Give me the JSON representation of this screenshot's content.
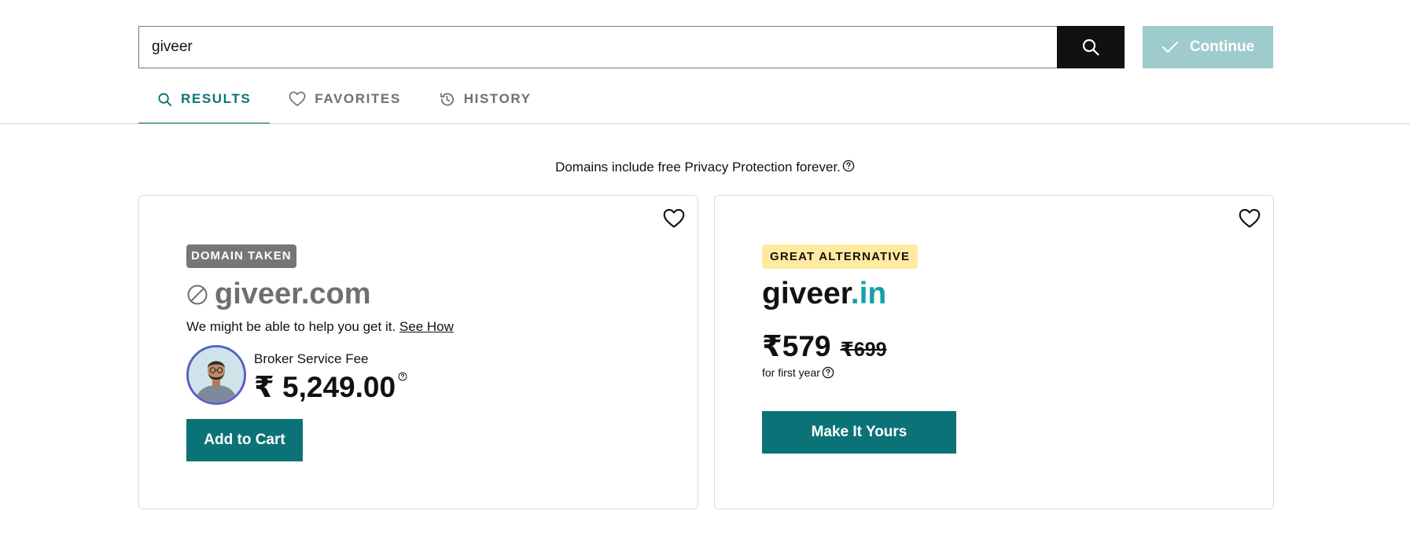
{
  "search": {
    "value": "giveer",
    "search_icon": "search-icon",
    "continue_label": "Continue",
    "continue_icon": "checkmark-icon"
  },
  "tabs": [
    {
      "label": "RESULTS",
      "icon": "search-icon",
      "active": true
    },
    {
      "label": "FAVORITES",
      "icon": "heart-icon",
      "active": false
    },
    {
      "label": "HISTORY",
      "icon": "history-icon",
      "active": false
    }
  ],
  "privacy_note": "Domains include free Privacy Protection forever.",
  "taken_card": {
    "badge": "DOMAIN TAKEN",
    "domain": "giveer.com",
    "helper_text": "We might be able to help you get it.",
    "see_how": "See How",
    "broker_label": "Broker Service Fee",
    "broker_price": "₹ 5,249.00",
    "button": "Add to Cart",
    "favorite_icon": "heart-outline-icon",
    "unavailable_icon": "not-available-icon"
  },
  "alternative_card": {
    "badge": "GREAT ALTERNATIVE",
    "domain_name": "giveer",
    "domain_tld": ".in",
    "price": "₹579",
    "original_price": "₹699",
    "price_term": "for first year",
    "button": "Make It Yours",
    "favorite_icon": "heart-outline-icon"
  },
  "colors": {
    "accent": "#0b7377",
    "tld_teal": "#15a0a8",
    "continue_disabled": "#9ecbcb",
    "badge_taken": "#767676",
    "badge_alternative": "#ffeaa0",
    "avatar_ring": "#5b5fc7"
  }
}
